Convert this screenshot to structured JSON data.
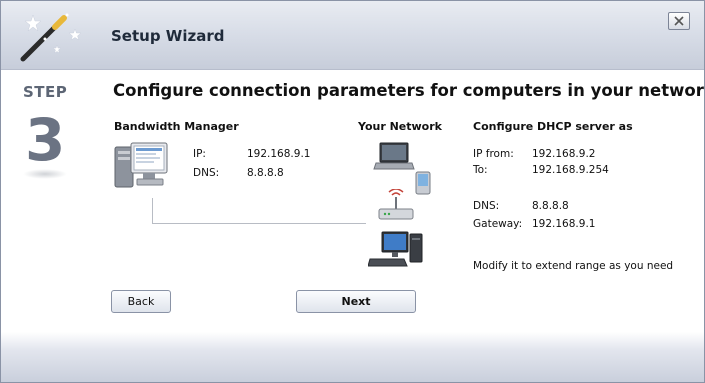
{
  "header": {
    "title": "Setup Wizard"
  },
  "step": {
    "label": "STEP",
    "number": "3"
  },
  "headline": "Configure connection parameters for computers in your network.",
  "bandwidth_manager": {
    "title": "Bandwidth Manager",
    "ip_label": "IP:",
    "ip_value": "192.168.9.1",
    "dns_label": "DNS:",
    "dns_value": "8.8.8.8"
  },
  "your_network": {
    "title": "Your Network"
  },
  "dhcp": {
    "title": "Configure DHCP server as",
    "ip_from_label": "IP from:",
    "ip_from_value": "192.168.9.2",
    "to_label": "To:",
    "to_value": "192.168.9.254",
    "dns_label": "DNS:",
    "dns_value": "8.8.8.8",
    "gateway_label": "Gateway:",
    "gateway_value": "192.168.9.1",
    "note": "Modify it to extend range as you need"
  },
  "buttons": {
    "back": "Back",
    "next": "Next"
  },
  "icons": [
    "magic-wand-icon",
    "close-icon",
    "server-computer-icon",
    "laptop-icon",
    "pda-icon",
    "router-icon",
    "desktop-computer-icon"
  ]
}
